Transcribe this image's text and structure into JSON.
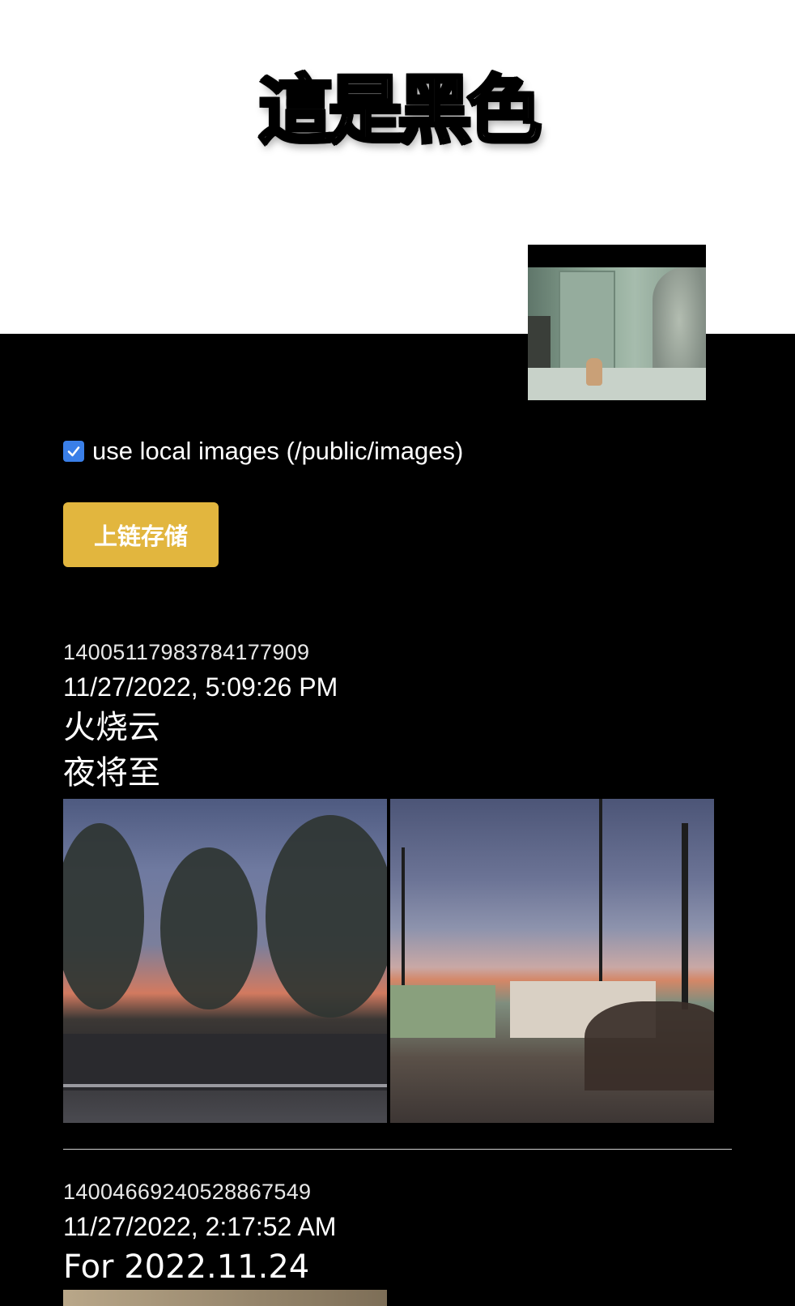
{
  "banner": {
    "title": "這是黑色"
  },
  "settings": {
    "use_local_images_label": "use local images (/public/images)",
    "use_local_images_checked": true,
    "save_button_label": "上链存储"
  },
  "posts": [
    {
      "id": "1400511798378417790 9",
      "date": "11/27/2022, 5:09:26 PM",
      "lines": [
        "火烧云",
        "夜将至"
      ]
    },
    {
      "id": "1400466924052886754 9",
      "date": "11/27/2022, 2:17:52 AM",
      "lines": [
        "For 2022.11.24"
      ]
    }
  ],
  "colors": {
    "button": "#e2b63e",
    "checkbox": "#3a7fe8",
    "background": "#000000"
  }
}
